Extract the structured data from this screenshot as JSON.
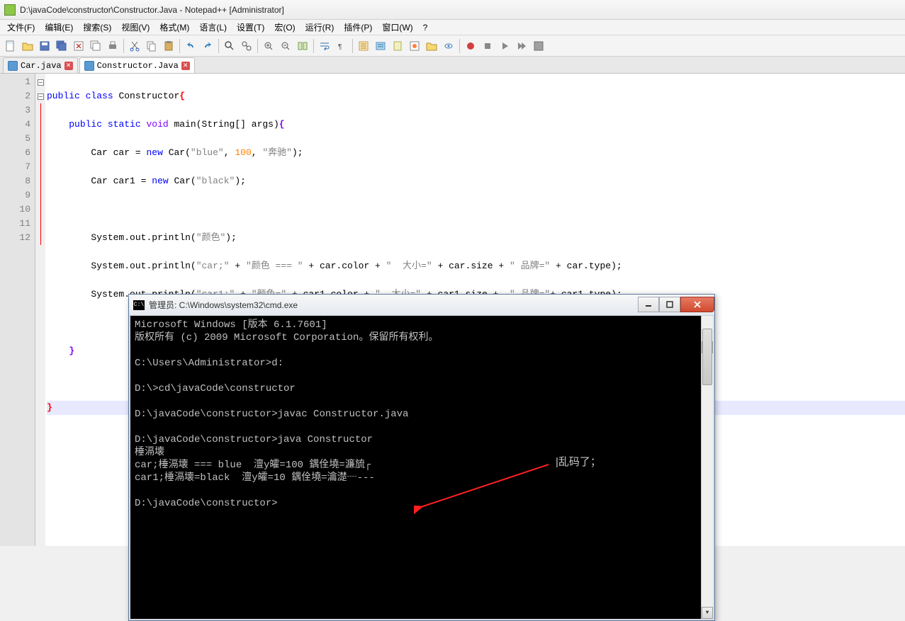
{
  "window": {
    "title": "D:\\javaCode\\constructor\\Constructor.Java - Notepad++ [Administrator]"
  },
  "menu": {
    "file": "文件(F)",
    "edit": "编辑(E)",
    "search": "搜索(S)",
    "view": "视图(V)",
    "format": "格式(M)",
    "language": "语言(L)",
    "settings": "设置(T)",
    "macro": "宏(O)",
    "run": "运行(R)",
    "plugins": "插件(P)",
    "window": "窗口(W)",
    "help": "?"
  },
  "tabs": [
    {
      "label": "Car.java",
      "active": false
    },
    {
      "label": "Constructor.Java",
      "active": true
    }
  ],
  "code": {
    "lines": [
      "public class Constructor{",
      "    public static void main(String[] args){",
      "        Car car = new Car(\"blue\", 100, \"奔驰\");",
      "        Car car1 = new Car(\"black\");",
      "",
      "        System.out.println(\"颜色\");",
      "        System.out.println(\"car;\" + \"颜色 === \" + car.color + \"  大小=\" + car.size + \" 品牌=\" + car.type);",
      "        System.out.println(\"car1;\" + \"颜色=\" + car1.color + \"  大小=\" + car1.size +  \" 品牌=\"+ car1.type);",
      "",
      "    }",
      "",
      "}"
    ]
  },
  "cmd": {
    "title": "管理员: C:\\Windows\\system32\\cmd.exe",
    "lines": [
      "Microsoft Windows [版本 6.1.7601]",
      "版权所有 (c) 2009 Microsoft Corporation。保留所有权利。",
      "",
      "C:\\Users\\Administrator>d:",
      "",
      "D:\\>cd\\javaCode\\constructor",
      "",
      "D:\\javaCode\\constructor>javac Constructor.java",
      "",
      "D:\\javaCode\\constructor>java Constructor",
      "棰滆壊",
      "car;棰滆壊 === blue  澶у皬=100 鍝佺墝=濂旈┌",
      "car1;棰滆壊=black  澶у皬=10 鍝佺墝=瀹濋┈---",
      "",
      "D:\\javaCode\\constructor>"
    ]
  },
  "annotation": {
    "label": "|乱码了；"
  }
}
